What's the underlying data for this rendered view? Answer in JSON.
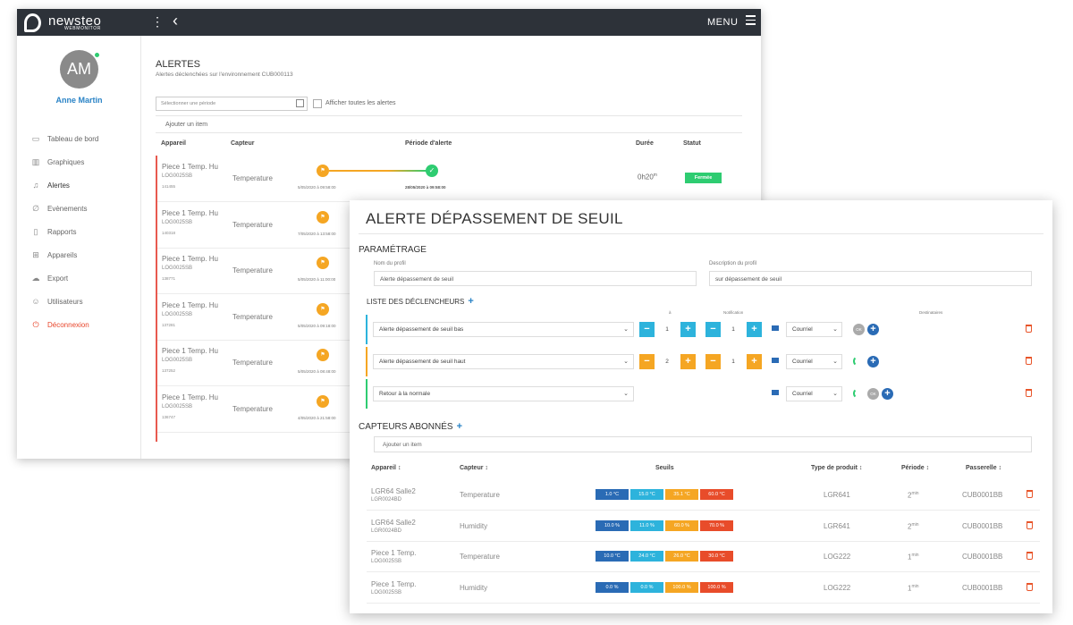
{
  "brand": {
    "name": "newsteo",
    "product": "WEBMONITOR"
  },
  "topbar": {
    "menu_label": "MENU"
  },
  "user": {
    "initials": "AM",
    "name": "Anne Martin"
  },
  "nav": [
    {
      "label": "Tableau de bord",
      "icon": "monitor-icon"
    },
    {
      "label": "Graphiques",
      "icon": "chart-icon"
    },
    {
      "label": "Alertes",
      "icon": "bell-icon"
    },
    {
      "label": "Evènements",
      "icon": "paperclip-icon"
    },
    {
      "label": "Rapports",
      "icon": "report-icon"
    },
    {
      "label": "Appareils",
      "icon": "grid-icon"
    },
    {
      "label": "Export",
      "icon": "cloud-icon"
    },
    {
      "label": "Utilisateurs",
      "icon": "user-icon"
    },
    {
      "label": "Déconnexion",
      "icon": "power-icon"
    }
  ],
  "alerts": {
    "title": "ALERTES",
    "subtitle": "Alertes déclenchées sur l'environnement CUB000113",
    "period_placeholder": "Sélectionner une période",
    "show_all_label": "Afficher toutes les alertes",
    "add_item": "Ajouter un item",
    "columns": {
      "device": "Appareil",
      "sensor": "Capteur",
      "period": "Période d'alerte",
      "duration": "Durée",
      "status": "Statut"
    },
    "rows": [
      {
        "device": "Piece 1 Temp. Hu",
        "code": "LOG0025SB",
        "num": "141455",
        "sensor": "Temperature",
        "start": "5/05/2020 à 09:58:00",
        "end": "28/05/2020 à 09:58:00",
        "duration": "0h20",
        "duration_unit": "m",
        "status": "Fermée"
      },
      {
        "device": "Piece 1 Temp. Hu",
        "code": "LOG0025SB",
        "num": "140318",
        "sensor": "Temperature",
        "start": "7/05/2020 à 13:58:00"
      },
      {
        "device": "Piece 1 Temp. Hu",
        "code": "LOG0025SB",
        "num": "138771",
        "sensor": "Temperature",
        "start": "5/05/2020 à 11:00:00"
      },
      {
        "device": "Piece 1 Temp. Hu",
        "code": "LOG0025SB",
        "num": "137281",
        "sensor": "Temperature",
        "start": "5/05/2020 à 09:18:00"
      },
      {
        "device": "Piece 1 Temp. Hu",
        "code": "LOG0025SB",
        "num": "137252",
        "sensor": "Temperature",
        "start": "5/05/2020 à 08:48:00"
      },
      {
        "device": "Piece 1 Temp. Hu",
        "code": "LOG0025SB",
        "num": "136747",
        "sensor": "Temperature",
        "start": "4/05/2020 à 21:58:00"
      }
    ]
  },
  "modal": {
    "title": "ALERTE DÉPASSEMENT DE SEUIL",
    "param_section": "PARAMÉTRAGE",
    "profile_name_label": "Nom du profil",
    "profile_name_value": "Alerte dépassement de seuil",
    "profile_desc_label": "Description du profil",
    "profile_desc_value": "sur dépassement de seuil",
    "triggers_section": "LISTE DES DÉCLENCHEURS",
    "trigger_headers": {
      "a": "à",
      "notification": "Notification",
      "recipients": "Destinataires"
    },
    "triggers": [
      {
        "label": "Alerte dépassement de seuil bas",
        "color": "#2db3dc",
        "val1": "1",
        "val2": "1",
        "channel": "Courriel",
        "ok": "OK",
        "steppers": true
      },
      {
        "label": "Alerte dépassement de seuil haut",
        "color": "#f5a623",
        "val1": "2",
        "val2": "1",
        "channel": "Courriel",
        "ok": "",
        "steppers": true
      },
      {
        "label": "Retour à la normale",
        "color": "#2ecc71",
        "channel": "Courriel",
        "ok": "OK",
        "steppers": false
      }
    ],
    "sensors_section": "CAPTEURS ABONNÉS",
    "sensor_add_item": "Ajouter un item",
    "sensor_columns": {
      "device": "Appareil",
      "sensor": "Capteur",
      "thresholds": "Seuils",
      "product": "Type de produit",
      "period": "Période",
      "gateway": "Passerelle"
    },
    "sensors": [
      {
        "name": "LGR64 Salle2",
        "code": "LGR0024BD",
        "measure": "Temperature",
        "thresholds": [
          "1.0 °C",
          "15.0 °C",
          "35.1 °C",
          "60.0 °C"
        ],
        "product": "LGR641",
        "period": "2",
        "period_unit": "min",
        "gateway": "CUB0001BB"
      },
      {
        "name": "LGR64 Salle2",
        "code": "LGR0024BD",
        "measure": "Humidity",
        "thresholds": [
          "10.0 %",
          "11.0 %",
          "60.0 %",
          "70.0 %"
        ],
        "product": "LGR641",
        "period": "2",
        "period_unit": "min",
        "gateway": "CUB0001BB"
      },
      {
        "name": "Piece 1 Temp.",
        "code": "LOG0025SB",
        "measure": "Temperature",
        "thresholds": [
          "10.0 °C",
          "24.0 °C",
          "26.0 °C",
          "30.0 °C"
        ],
        "product": "LOG222",
        "period": "1",
        "period_unit": "min",
        "gateway": "CUB0001BB"
      },
      {
        "name": "Piece 1 Temp.",
        "code": "LOG0025SB",
        "measure": "Humidity",
        "thresholds": [
          "0.0 %",
          "0.0 %",
          "100.0 %",
          "100.0 %"
        ],
        "product": "LOG222",
        "period": "1",
        "period_unit": "min",
        "gateway": "CUB0001BB"
      }
    ],
    "threshold_colors": [
      "#2a6bb5",
      "#2db3dc",
      "#f5a623",
      "#e84c2a"
    ]
  }
}
